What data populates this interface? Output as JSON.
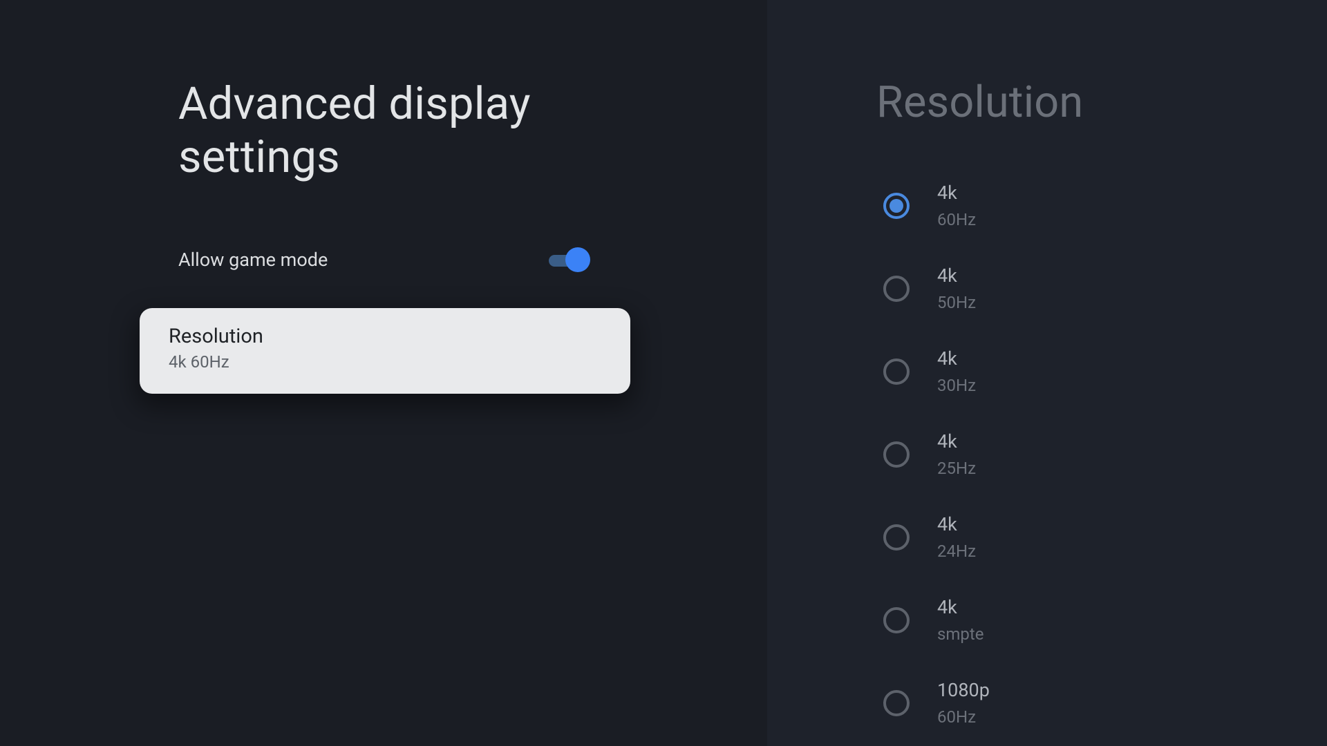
{
  "left": {
    "title": "Advanced display settings",
    "game_mode": {
      "label": "Allow game mode",
      "on": true
    },
    "resolution_card": {
      "label": "Resolution",
      "value": "4k 60Hz"
    }
  },
  "right": {
    "title": "Resolution",
    "selected_index": 0,
    "options": [
      {
        "label": "4k",
        "sub": "60Hz"
      },
      {
        "label": "4k",
        "sub": "50Hz"
      },
      {
        "label": "4k",
        "sub": "30Hz"
      },
      {
        "label": "4k",
        "sub": "25Hz"
      },
      {
        "label": "4k",
        "sub": "24Hz"
      },
      {
        "label": "4k",
        "sub": "smpte"
      },
      {
        "label": "1080p",
        "sub": "60Hz"
      }
    ]
  }
}
